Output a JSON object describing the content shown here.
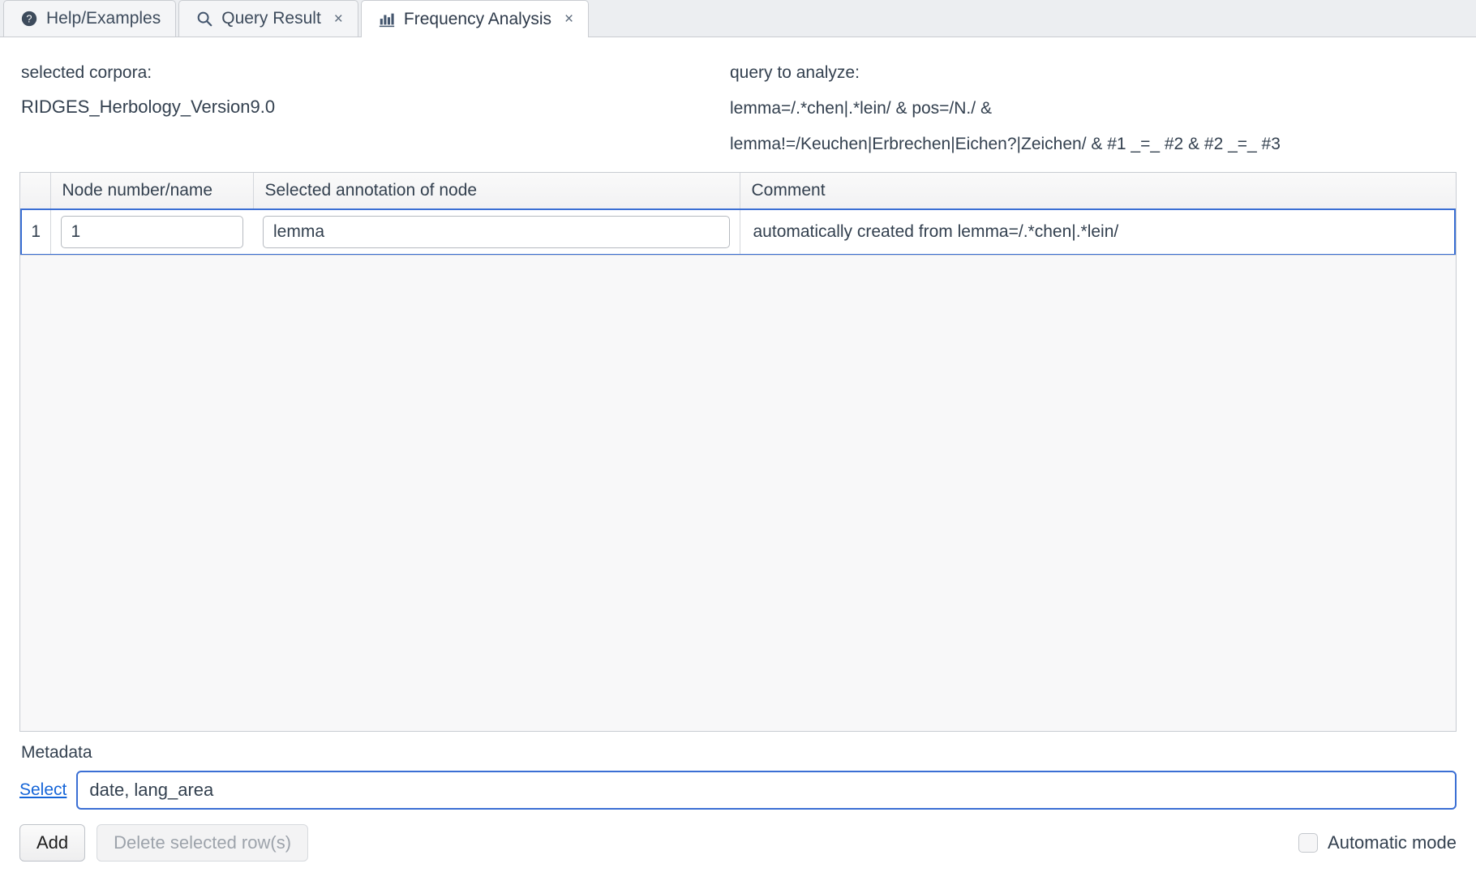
{
  "tabs": [
    {
      "label": "Help/Examples",
      "icon": "help-circle-icon",
      "closable": false,
      "selected": false
    },
    {
      "label": "Query Result",
      "icon": "search-icon",
      "closable": true,
      "selected": false
    },
    {
      "label": "Frequency Analysis",
      "icon": "bar-chart-icon",
      "closable": true,
      "selected": true
    }
  ],
  "close_glyph": "×",
  "corpora": {
    "label": "selected corpora:",
    "name": "RIDGES_Herbology_Version9.0"
  },
  "query": {
    "label": "query to analyze:",
    "line1": "lemma=/.*chen|.*lein/ & pos=/N./ &",
    "line2": "lemma!=/Keuchen|Erbrechen|Eichen?|Zeichen/ & #1 _=_ #2 & #2 _=_ #3"
  },
  "table": {
    "headers": [
      "",
      "Node number/name",
      "Selected annotation of node",
      "Comment"
    ],
    "rows": [
      {
        "index": "1",
        "node": "1",
        "annotation": "lemma",
        "comment": "automatically created from lemma=/.*chen|.*lein/"
      }
    ]
  },
  "metadata": {
    "label": "Metadata",
    "select_link": "Select",
    "value": "date, lang_area"
  },
  "footer": {
    "add_label": "Add",
    "delete_label": "Delete selected row(s)",
    "automatic_mode_label": "Automatic mode",
    "automatic_mode_checked": false
  },
  "colors": {
    "accent": "#3b6fd4",
    "link": "#1565d8",
    "text": "#33404f",
    "tabbar_bg": "#eceef1",
    "panel_bg": "#f8f8f9"
  }
}
